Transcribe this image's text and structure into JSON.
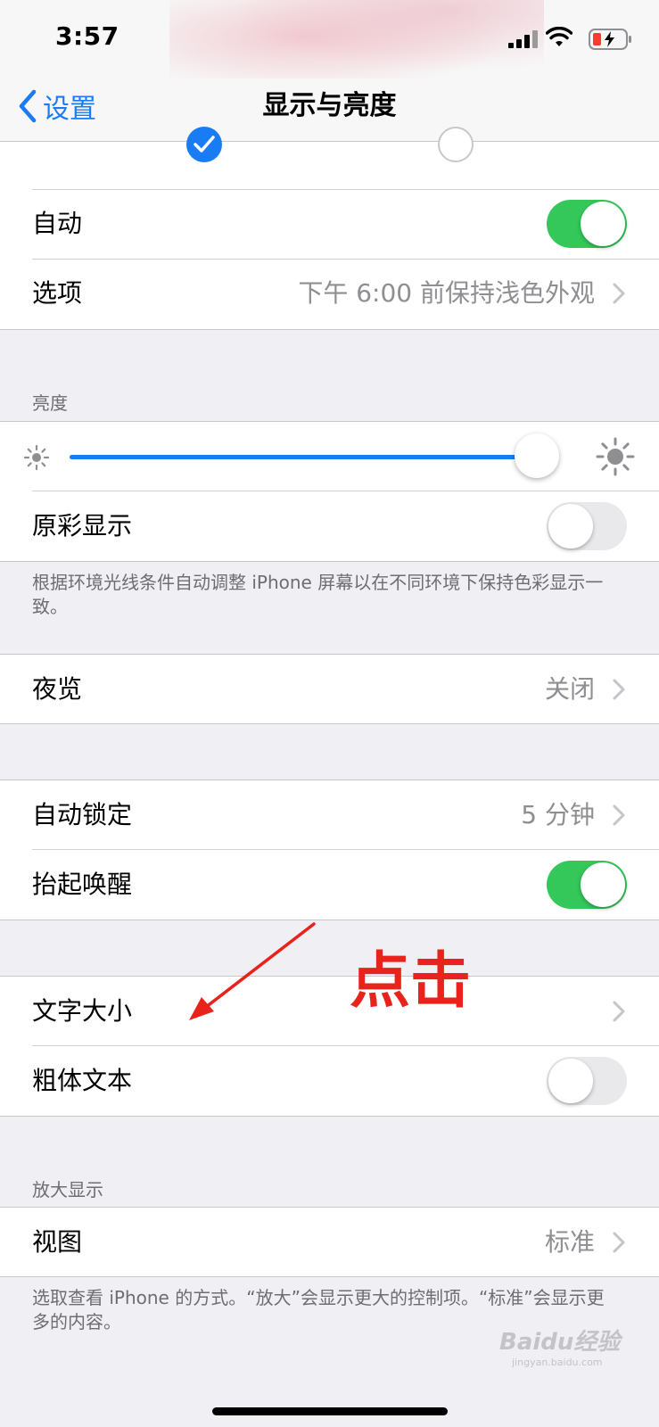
{
  "status_bar": {
    "time": "3:57"
  },
  "nav": {
    "back_label": "设置",
    "title": "显示与亮度"
  },
  "appearance": {
    "selected": "light",
    "auto_label": "自动",
    "auto_on": true,
    "options_label": "选项",
    "options_value": "下午 6:00 前保持浅色外观"
  },
  "brightness": {
    "header": "亮度",
    "level": 0.97,
    "true_tone_label": "原彩显示",
    "true_tone_on": false,
    "footer": "根据环境光线条件自动调整 iPhone 屏幕以在不同环境下保持色彩显示一致。"
  },
  "night_shift": {
    "label": "夜览",
    "value": "关闭"
  },
  "lock": {
    "auto_lock_label": "自动锁定",
    "auto_lock_value": "5 分钟",
    "raise_label": "抬起唤醒",
    "raise_on": true
  },
  "text": {
    "size_label": "文字大小",
    "bold_label": "粗体文本",
    "bold_on": false
  },
  "zoom": {
    "header": "放大显示",
    "view_label": "视图",
    "view_value": "标准",
    "footer": "选取查看 iPhone 的方式。“放大”会显示更大的控制项。“标准”会显示更多的内容。"
  },
  "annotation": {
    "text": "点击",
    "color": "#e8231b"
  },
  "watermark": {
    "text": "Baidu经验",
    "sub": "jingyan.baidu.com"
  },
  "colors": {
    "accent": "#1a7cf5",
    "toggle_on": "#34c759"
  }
}
